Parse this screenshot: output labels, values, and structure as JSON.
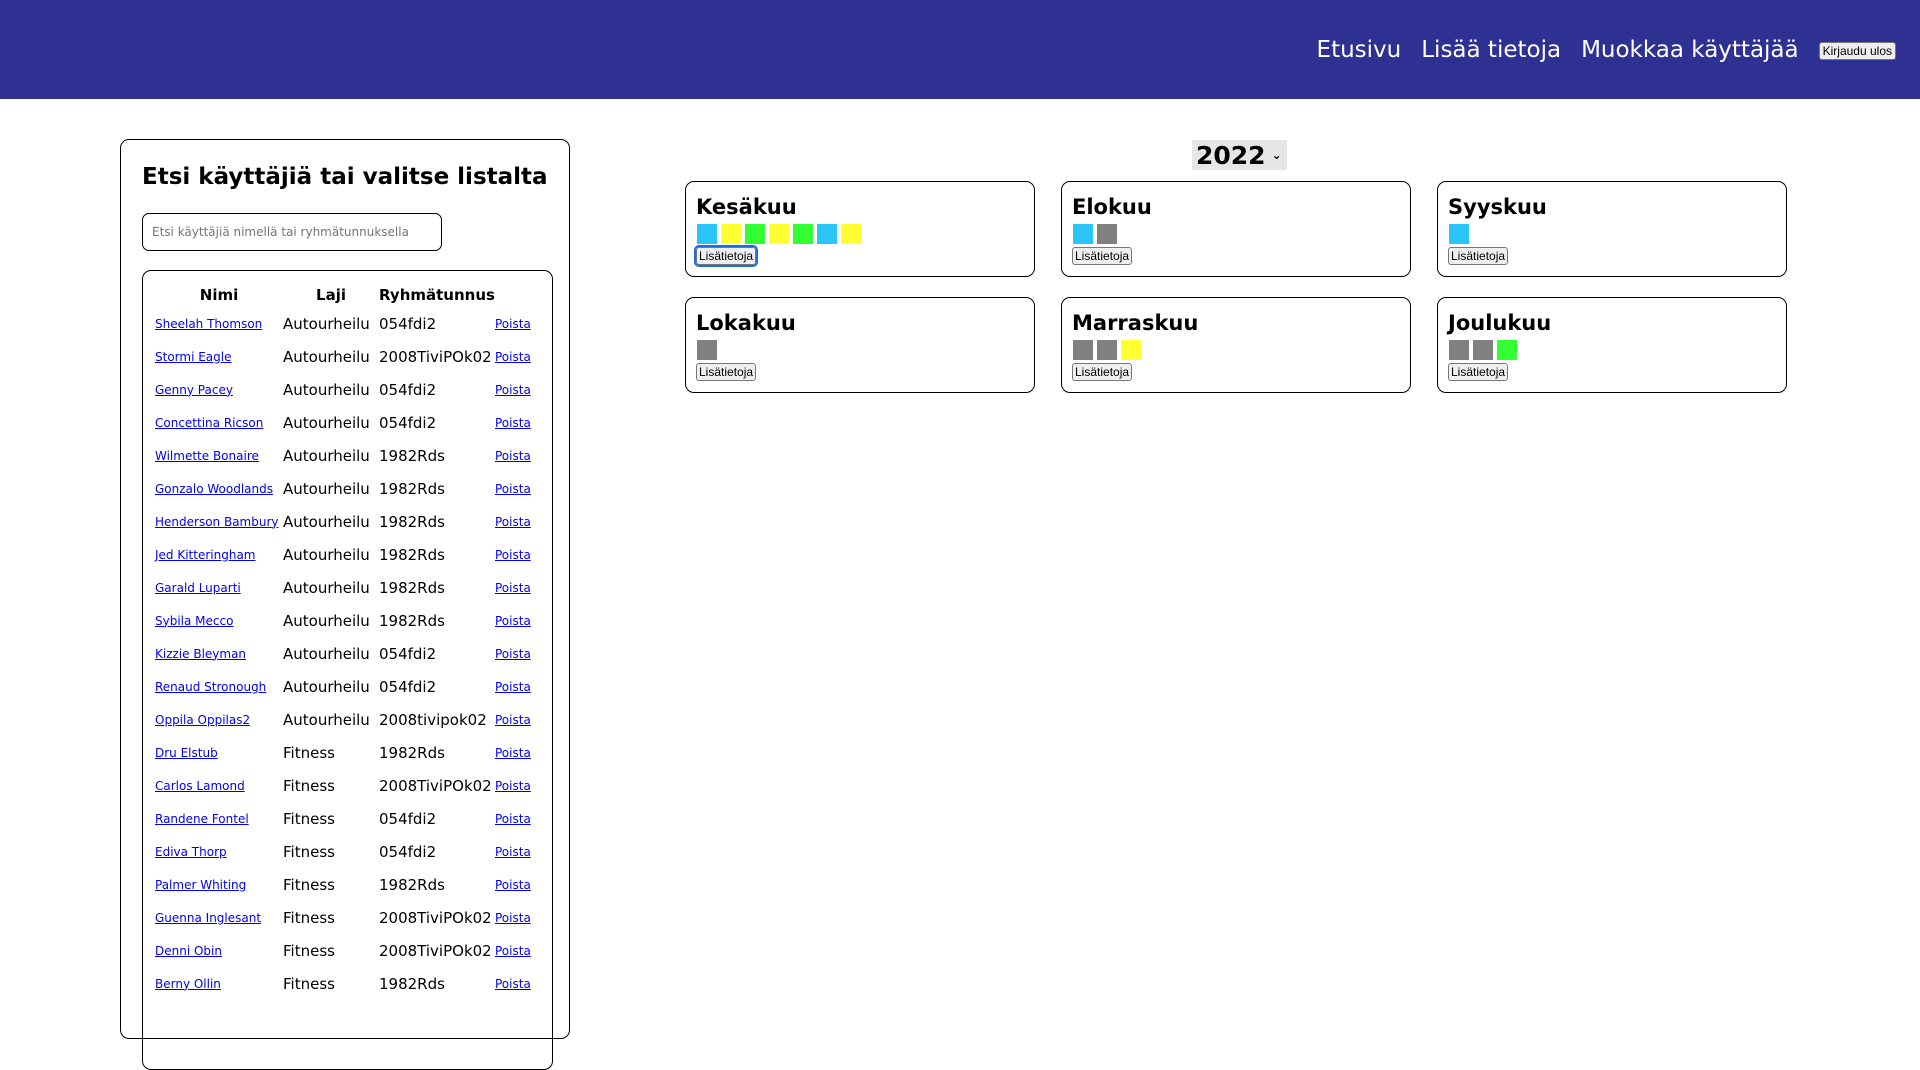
{
  "nav": {
    "home": "Etusivu",
    "add_info": "Lisää tietoja",
    "edit_user": "Muokkaa käyttäjää",
    "logout": "Kirjaudu ulos"
  },
  "panel": {
    "title": "Etsi käyttäjiä tai valitse listalta",
    "search_placeholder": "Etsi käyttäjiä nimellä tai ryhmätunnuksella",
    "headers": {
      "name": "Nimi",
      "sport": "Laji",
      "group": "Ryhmätunnus"
    },
    "delete_label": "Poista",
    "rows": [
      {
        "name": "Sheelah Thomson",
        "sport": "Autourheilu",
        "group": "054fdi2"
      },
      {
        "name": "Stormi Eagle",
        "sport": "Autourheilu",
        "group": "2008TiviPOk02"
      },
      {
        "name": "Genny Pacey",
        "sport": "Autourheilu",
        "group": "054fdi2"
      },
      {
        "name": "Concettina Ricson",
        "sport": "Autourheilu",
        "group": "054fdi2"
      },
      {
        "name": "Wilmette Bonaire",
        "sport": "Autourheilu",
        "group": "1982Rds"
      },
      {
        "name": "Gonzalo Woodlands",
        "sport": "Autourheilu",
        "group": "1982Rds"
      },
      {
        "name": "Henderson Bambury",
        "sport": "Autourheilu",
        "group": "1982Rds"
      },
      {
        "name": "Jed Kitteringham",
        "sport": "Autourheilu",
        "group": "1982Rds"
      },
      {
        "name": "Garald Luparti",
        "sport": "Autourheilu",
        "group": "1982Rds"
      },
      {
        "name": "Sybila Mecco",
        "sport": "Autourheilu",
        "group": "1982Rds"
      },
      {
        "name": "Kizzie Bleyman",
        "sport": "Autourheilu",
        "group": "054fdi2"
      },
      {
        "name": "Renaud Stronough",
        "sport": "Autourheilu",
        "group": "054fdi2"
      },
      {
        "name": "Oppila Oppilas2",
        "sport": "Autourheilu",
        "group": "2008tivipok02"
      },
      {
        "name": "Dru Elstub",
        "sport": "Fitness",
        "group": "1982Rds"
      },
      {
        "name": "Carlos Lamond",
        "sport": "Fitness",
        "group": "2008TiviPOk02"
      },
      {
        "name": "Randene Fontel",
        "sport": "Fitness",
        "group": "054fdi2"
      },
      {
        "name": "Ediva Thorp",
        "sport": "Fitness",
        "group": "054fdi2"
      },
      {
        "name": "Palmer Whiting",
        "sport": "Fitness",
        "group": "1982Rds"
      },
      {
        "name": "Guenna Inglesant",
        "sport": "Fitness",
        "group": "2008TiviPOk02"
      },
      {
        "name": "Denni Obin",
        "sport": "Fitness",
        "group": "2008TiviPOk02"
      },
      {
        "name": "Berny Ollin",
        "sport": "Fitness",
        "group": "1982Rds"
      }
    ]
  },
  "year": "2022",
  "more_label": "Lisätietoja",
  "colors": {
    "blue": "#29c5f6",
    "yellow": "#ffff33",
    "green": "#33ff33",
    "gray": "#808080"
  },
  "months": [
    {
      "name": "Kesäkuu",
      "squares": [
        "blue",
        "yellow",
        "green",
        "yellow",
        "green",
        "blue",
        "yellow"
      ]
    },
    {
      "name": "Elokuu",
      "squares": [
        "blue",
        "gray"
      ]
    },
    {
      "name": "Syyskuu",
      "squares": [
        "blue"
      ]
    },
    {
      "name": "Lokakuu",
      "squares": [
        "gray"
      ]
    },
    {
      "name": "Marraskuu",
      "squares": [
        "gray",
        "gray",
        "yellow"
      ]
    },
    {
      "name": "Joulukuu",
      "squares": [
        "gray",
        "gray",
        "green"
      ]
    }
  ]
}
